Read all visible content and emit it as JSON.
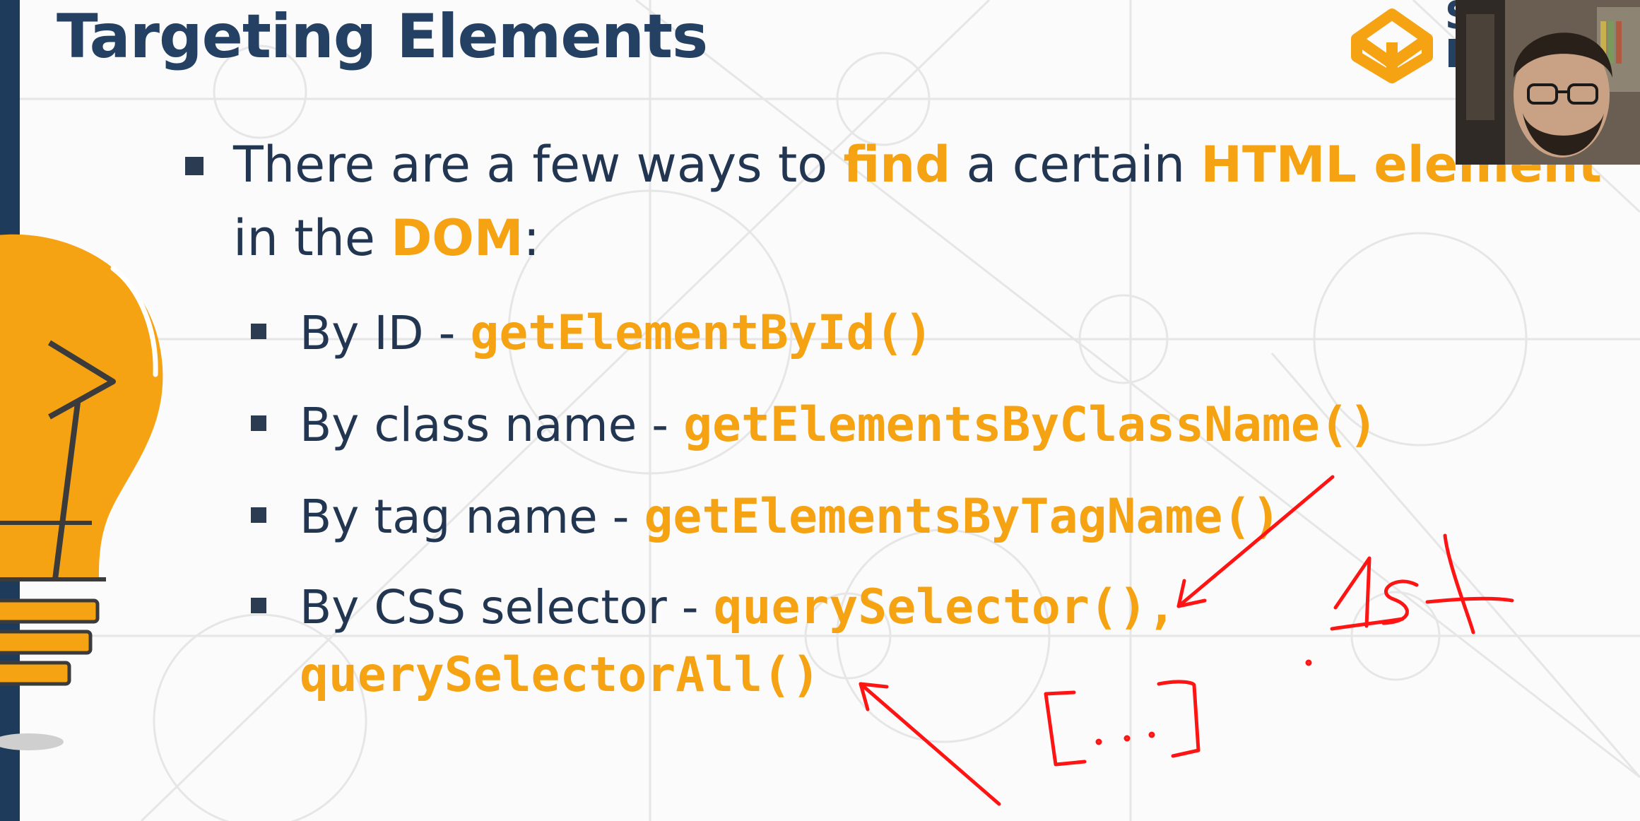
{
  "slide": {
    "title": "Targeting Elements",
    "intro": {
      "part1": "There are a few ways to ",
      "find": "find",
      "part2": " a certain ",
      "html_element": "HTML element",
      "line2_prefix": "in the ",
      "dom": "DOM",
      "line2_suffix": ":"
    },
    "methods": [
      {
        "label": "By ID - ",
        "code": "getElementById()"
      },
      {
        "label": "By class name - ",
        "code": "getElementsByClassName()"
      },
      {
        "label": "By tag name - ",
        "code": "getElementsByTagName()"
      },
      {
        "label": "By CSS selector - ",
        "code": "querySelector(),",
        "code2": "querySelectorAll()"
      }
    ]
  },
  "logo": {
    "partial_text": "S"
  },
  "annotations": {
    "color": "#ff1414",
    "handwritten": [
      "1st",
      "[...]"
    ]
  },
  "colors": {
    "title": "#244163",
    "body_text": "#223652",
    "highlight": "#f5a313",
    "left_bar": "#1f3b5b"
  }
}
